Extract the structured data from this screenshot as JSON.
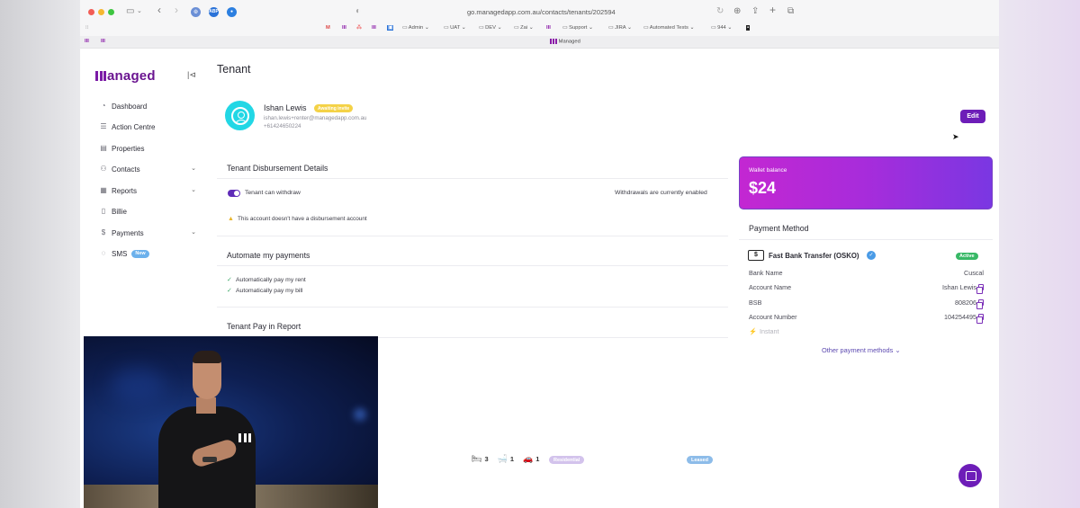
{
  "browser": {
    "url": "go.managedapp.com.au/contacts/tenants/202594",
    "tab_title": "Managed",
    "bookmarks": [
      "Admin",
      "UAT",
      "DEV",
      "Zai",
      "Support",
      "JIRA",
      "Automated Tests",
      "944"
    ]
  },
  "brand": {
    "name": "anaged",
    "accent": "#6d1db8"
  },
  "sidebar": {
    "items": [
      {
        "label": "Dashboard",
        "icon": "dashboard-icon"
      },
      {
        "label": "Action Centre",
        "icon": "list-icon"
      },
      {
        "label": "Properties",
        "icon": "building-icon"
      },
      {
        "label": "Contacts",
        "icon": "contacts-icon",
        "expandable": true
      },
      {
        "label": "Reports",
        "icon": "reports-icon",
        "expandable": true
      },
      {
        "label": "Billie",
        "icon": "document-icon"
      },
      {
        "label": "Payments",
        "icon": "payments-icon",
        "expandable": true
      },
      {
        "label": "SMS",
        "icon": "chat-icon",
        "badge": "New"
      }
    ]
  },
  "page": {
    "title": "Tenant"
  },
  "tenant": {
    "name": "Ishan Lewis",
    "status": "Awaiting invite",
    "email": "ishan.lewis+renter@managedapp.com.au",
    "phone": "+61424650224",
    "edit_label": "Edit"
  },
  "disbursement": {
    "title": "Tenant Disbursement Details",
    "toggle_label": "Tenant can withdraw",
    "toggle_on": true,
    "status_text": "Withdrawals are currently enabled",
    "warning": "This account doesn't have a disbursement account"
  },
  "automate": {
    "title": "Automate my payments",
    "items": [
      "Automatically pay my rent",
      "Automatically pay my bill"
    ]
  },
  "report": {
    "title": "Tenant Pay in Report"
  },
  "wallet": {
    "label": "Wallet balance",
    "amount": "$24"
  },
  "payment_method": {
    "title": "Payment Method",
    "name": "Fast Bank Transfer (OSKO)",
    "status": "Active",
    "rows": [
      {
        "label": "Bank Name",
        "value": "Cuscal"
      },
      {
        "label": "Account Name",
        "value": "Ishan Lewis"
      },
      {
        "label": "BSB",
        "value": "808206"
      },
      {
        "label": "Account Number",
        "value": "104254495"
      }
    ],
    "speed": "Instant",
    "other_label": "Other payment methods"
  },
  "property": {
    "beds": "3",
    "baths": "1",
    "cars": "1",
    "type": "Residential",
    "status": "Leased"
  }
}
